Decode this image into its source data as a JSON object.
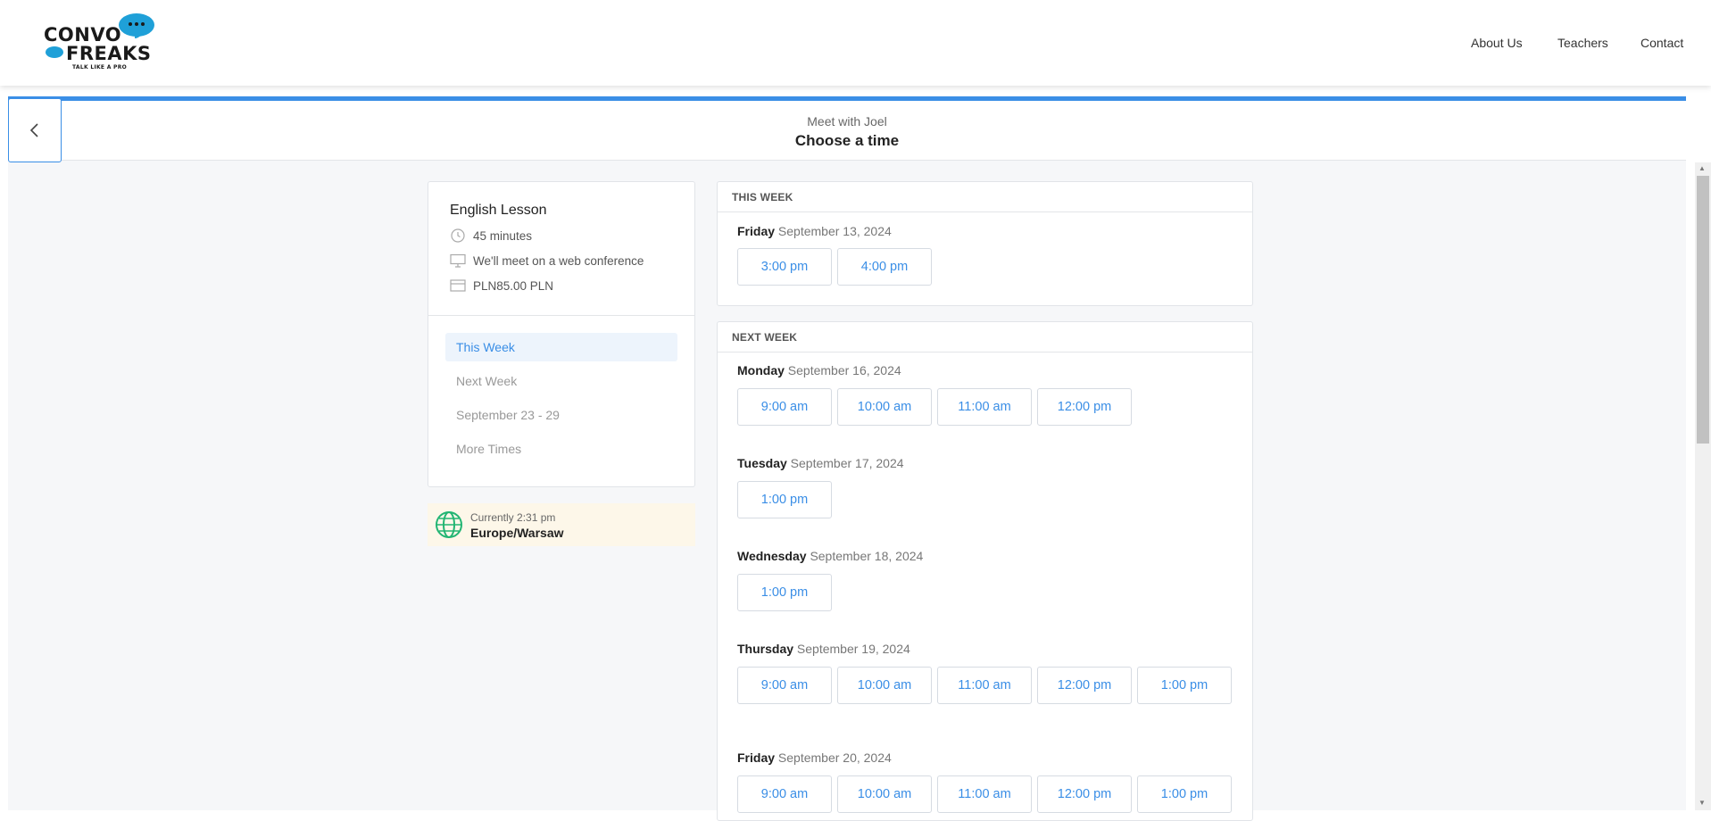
{
  "nav": {
    "logo_line1": "CONVO",
    "logo_line2": "FREAKS",
    "logo_tagline": "TALK LIKE A PRO",
    "links": [
      "About Us",
      "Teachers",
      "Contact"
    ]
  },
  "header": {
    "meet_with": "Meet with Joel",
    "title": "Choose a time"
  },
  "event": {
    "title": "English Lesson",
    "duration": "45 minutes",
    "location": "We'll meet on a web conference",
    "price": "PLN85.00 PLN"
  },
  "weeks_nav": [
    {
      "label": "This Week",
      "active": true
    },
    {
      "label": "Next Week",
      "active": false
    },
    {
      "label": "September 23 - 29",
      "active": false
    },
    {
      "label": "More Times",
      "active": false
    }
  ],
  "timezone": {
    "current": "Currently 2:31 pm",
    "zone": "Europe/Warsaw"
  },
  "this_week": {
    "heading": "THIS WEEK",
    "days": [
      {
        "day": "Friday",
        "date": "September 13, 2024",
        "slots": [
          "3:00 pm",
          "4:00 pm"
        ]
      }
    ]
  },
  "next_week": {
    "heading": "NEXT WEEK",
    "days": [
      {
        "day": "Monday",
        "date": "September 16, 2024",
        "slots": [
          "9:00 am",
          "10:00 am",
          "11:00 am",
          "12:00 pm"
        ]
      },
      {
        "day": "Tuesday",
        "date": "September 17, 2024",
        "slots": [
          "1:00 pm"
        ]
      },
      {
        "day": "Wednesday",
        "date": "September 18, 2024",
        "slots": [
          "1:00 pm"
        ]
      },
      {
        "day": "Thursday",
        "date": "September 19, 2024",
        "slots": [
          "9:00 am",
          "10:00 am",
          "11:00 am",
          "12:00 pm",
          "1:00 pm"
        ]
      },
      {
        "day": "Friday",
        "date": "September 20, 2024",
        "slots": [
          "9:00 am",
          "10:00 am",
          "11:00 am",
          "12:00 pm",
          "1:00 pm"
        ]
      }
    ]
  },
  "colors": {
    "accent": "#3a8ee6",
    "brand_bubble": "#1fa0d8",
    "timezone_bg": "#fdf7e9",
    "globe": "#22b573"
  },
  "icons": [
    "chevron-left-icon",
    "clock-icon",
    "monitor-icon",
    "credit-card-icon",
    "globe-icon"
  ]
}
